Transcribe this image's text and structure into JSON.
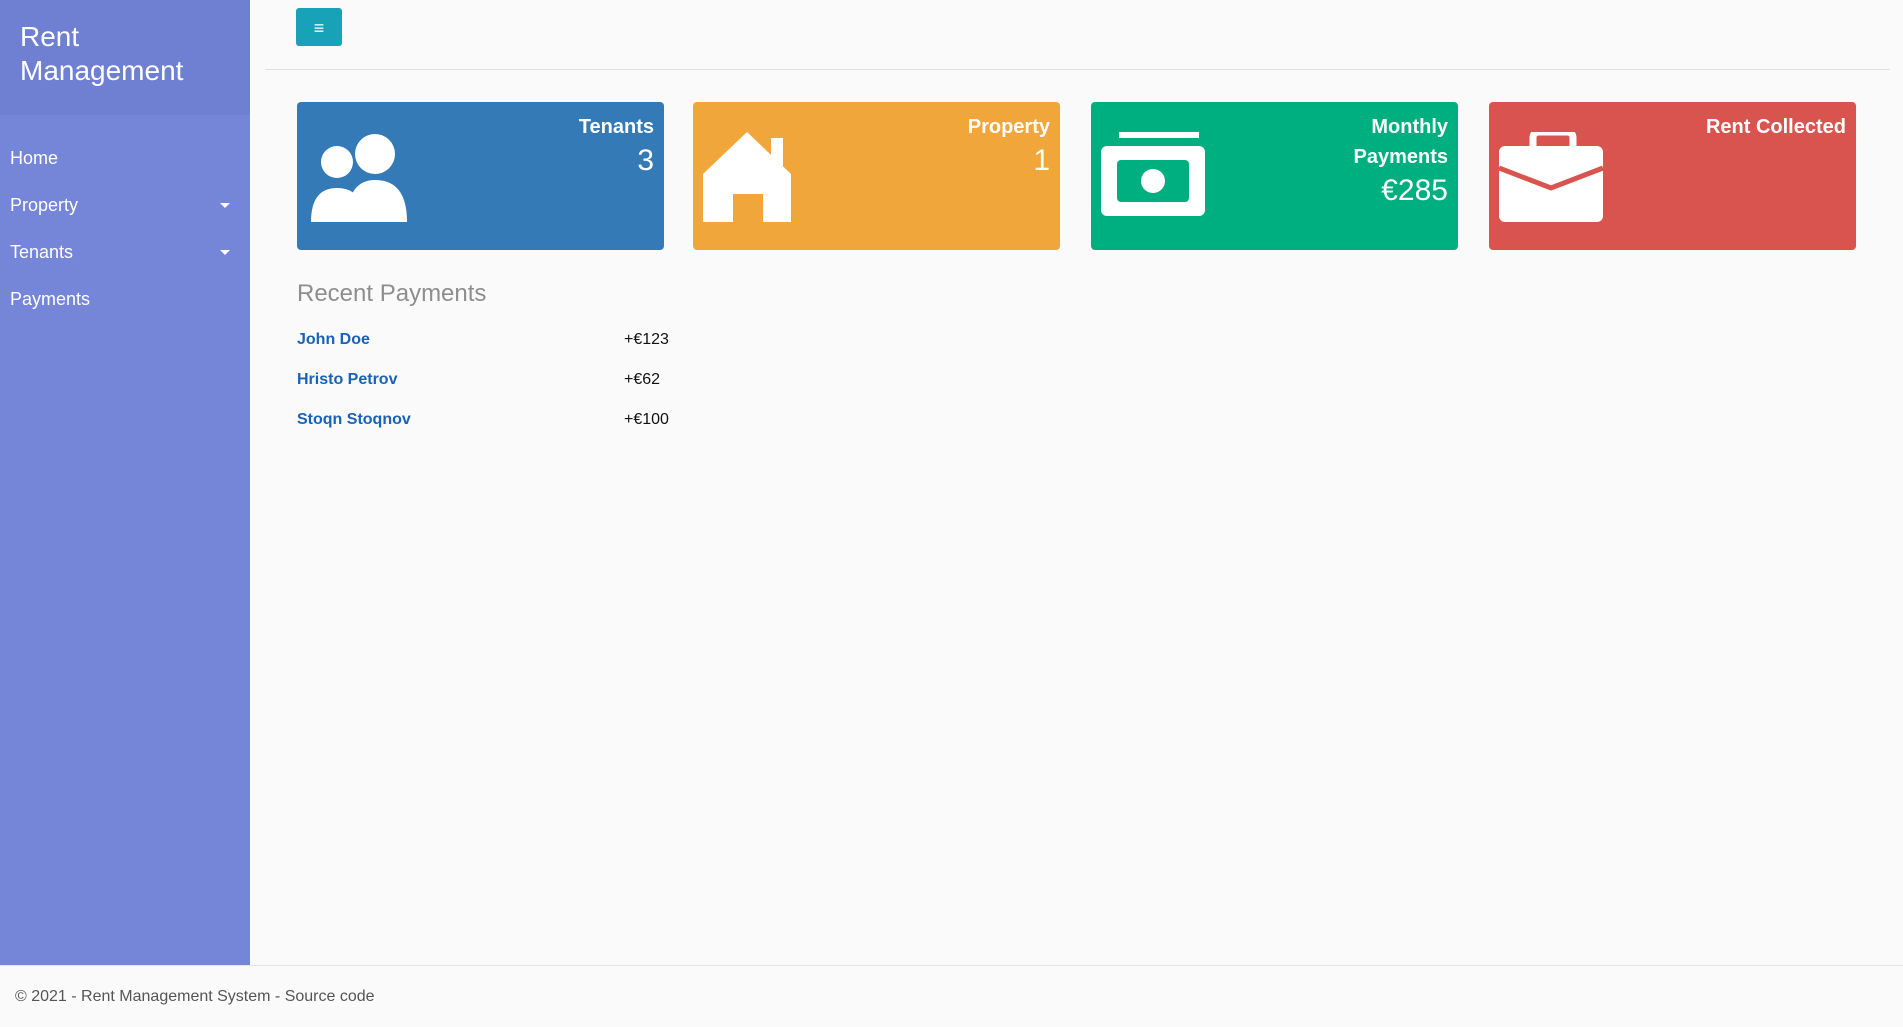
{
  "sidebar": {
    "brand": "Rent Management",
    "items": [
      {
        "label": "Home"
      },
      {
        "label": "Property"
      },
      {
        "label": "Tenants"
      },
      {
        "label": "Payments"
      }
    ]
  },
  "topbar": {
    "menu_toggle_label": "≡"
  },
  "cards": {
    "tenants": {
      "title": "Tenants",
      "value": "3",
      "color": "#337ab7",
      "icon": "users-icon"
    },
    "property": {
      "title": "Property",
      "value": "1",
      "color": "#f0a63a",
      "icon": "house-icon"
    },
    "monthly": {
      "title": "Monthly Payments",
      "value": "€285",
      "color": "#00af80",
      "icon": "money-icon"
    },
    "rent": {
      "title": "Rent Collected",
      "color": "#d9534f",
      "icon": "briefcase-icon"
    }
  },
  "recent": {
    "heading": "Recent Payments",
    "payments": [
      {
        "name": "John Doe",
        "amount": "+€123"
      },
      {
        "name": "Hristo Petrov",
        "amount": "+€62"
      },
      {
        "name": "Stoqn Stoqnov",
        "amount": "+€100"
      }
    ]
  },
  "footer": {
    "text": "© 2021 - Rent Management System - Source code"
  }
}
